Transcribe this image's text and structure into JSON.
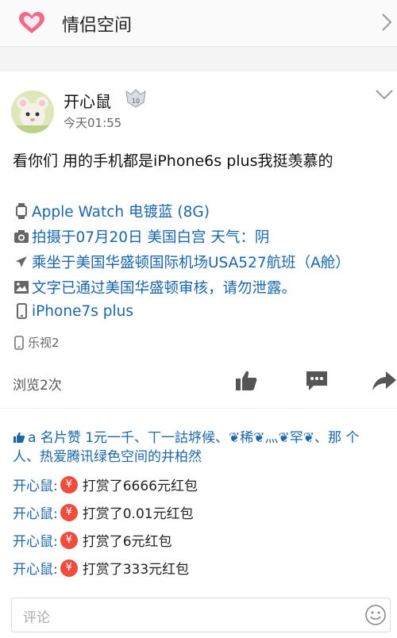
{
  "header": {
    "title": "情侣空间"
  },
  "post": {
    "username": "开心鼠",
    "badge_level": "10",
    "time": "今天01:55",
    "text": "看你们 用的手机都是iPhone6s plus我挺羡慕的",
    "meta": [
      {
        "icon": "watch-icon",
        "text": "Apple Watch  电镀蓝 (8G)"
      },
      {
        "icon": "camera-icon",
        "text": " 拍摄于07月20日   美国白宫 天气：阴"
      },
      {
        "icon": "plane-icon",
        "text": "乘坐于美国华盛顿国际机场USA527航班（A舱）"
      },
      {
        "icon": "image-icon",
        "text": "文字已通过美国华盛顿审核，请勿泄露。"
      },
      {
        "icon": "phone-icon",
        "text": "iPhone7s plus"
      }
    ],
    "device": "乐视2",
    "views": "浏览2次"
  },
  "likes": {
    "text": "a 名片赞 1元一千、丅一詁垿候、❦稀❦灬❦罕❦、那 个 人、热爱腾讯绿色空间的井柏然"
  },
  "rewards": [
    {
      "name": "开心鼠:",
      "amount": "打赏了6666元红包"
    },
    {
      "name": "开心鼠:",
      "amount": "打赏了0.01元红包"
    },
    {
      "name": "开心鼠:",
      "amount": "打赏了6元红包"
    },
    {
      "name": "开心鼠:",
      "amount": "打赏了333元红包"
    }
  ],
  "reward_symbol": "¥",
  "comment": {
    "placeholder": "评论"
  },
  "colors": {
    "link_blue": "#1a66a8",
    "reward_red": "#ee4d3d",
    "heart_pink": "#f06a8c"
  }
}
